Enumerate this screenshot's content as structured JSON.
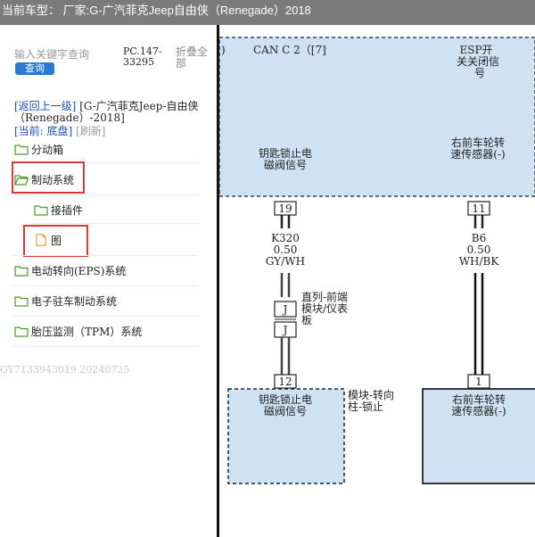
{
  "window": {
    "title": "当前车型：  厂家:G-广汽菲克Jeep自由侠（Renegade）2018"
  },
  "search": {
    "placeholder": "输入关键字查询",
    "button_label": "查询"
  },
  "pc_code": "PC.147-33295",
  "collapse_all_label": "折叠全部",
  "nav": {
    "back_label": "[返回上一级]",
    "back_text": "[G-广汽菲克Jeep-自由侠（Renegade）-2018]",
    "current_prefix": "[当前: ",
    "current_value": "底盘",
    "current_suffix": "]",
    "refresh_label": "[刷新]"
  },
  "tree": {
    "items": [
      {
        "label": "分动箱",
        "icon": "folder-icon"
      },
      {
        "label": "制动系统",
        "icon": "folder-open-icon",
        "highlighted": true
      },
      {
        "label": "接插件",
        "icon": "folder-icon"
      },
      {
        "label": "图",
        "icon": "document-icon",
        "highlighted": true
      },
      {
        "label": "电动转向(EPS)系统",
        "icon": "folder-icon"
      },
      {
        "label": "电子驻车制动系统",
        "icon": "folder-icon"
      },
      {
        "label": "胎压监测（TPM）系统",
        "icon": "folder-icon"
      }
    ]
  },
  "watermark": "GY7133943019.20240725",
  "diagram": {
    "top_paren": ")",
    "can_label": "CAN C 2（[7]",
    "esp_label": [
      "ESP开",
      "关关闭信",
      "号"
    ],
    "key_lock_signal": [
      "钥匙锁止电",
      "磁阀信号"
    ],
    "wheel_sensor": [
      "右前车轮转",
      "速传感器(-)"
    ],
    "pin_19": "19",
    "pin_11": "11",
    "pin_12": "12",
    "pin_1": "1",
    "wire_left": [
      "K320",
      "0.50",
      "GY/WH"
    ],
    "wire_right": [
      "B6",
      "0.50",
      "WH/BK"
    ],
    "connector_j": "J",
    "inline_note": [
      "直列-前端",
      "模块/仪表",
      "板"
    ],
    "module_note": [
      "模块-转向",
      "柱-锁止"
    ],
    "bottom_left_box": [
      "钥匙锁止电",
      "磁阀信号"
    ],
    "bottom_right_box": [
      "右前车轮转",
      "速传感器(-)"
    ]
  },
  "colors": {
    "title_bar": "#7b7b7b",
    "diagram_fill": "#cfe2f3",
    "highlight": "#d93838",
    "search_button": "#2a7ad3"
  }
}
